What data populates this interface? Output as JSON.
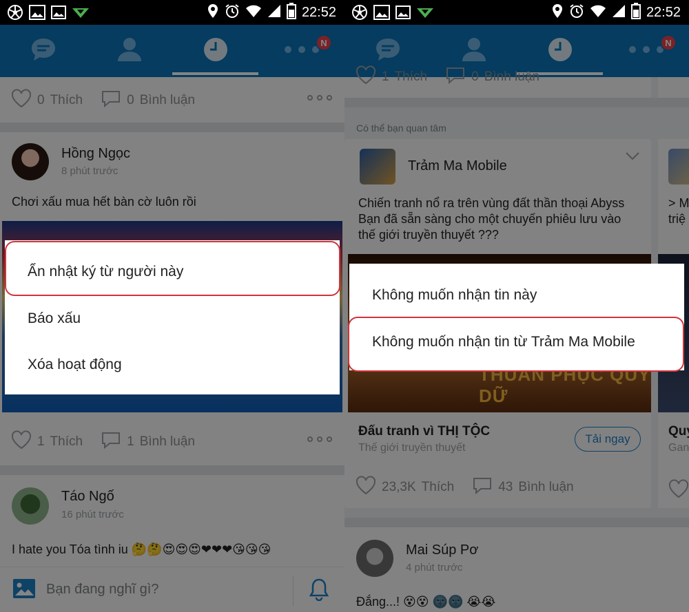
{
  "status_bar": {
    "time": "22:52"
  },
  "nav": {
    "badge": "N"
  },
  "left": {
    "top_post": {
      "likes": "0",
      "like_label": "Thích",
      "comments": "0",
      "comment_label": "Bình luận"
    },
    "post1": {
      "author": "Hồng Ngọc",
      "time": "8 phút trước",
      "text": "Chơi xấu mua hết bàn cờ luôn rồi",
      "likes": "1",
      "like_label": "Thích",
      "comments": "1",
      "comment_label": "Bình luận"
    },
    "post2": {
      "author": "Táo Ngố",
      "time": "16 phút trước",
      "text": "I hate you Tóa tình iu 🤔🤔😍😍😍❤❤❤😘😘😘"
    },
    "composer": {
      "placeholder": "Bạn đang nghĩ gì?"
    },
    "menu": {
      "items": [
        "Ẩn nhật ký từ người này",
        "Báo xấu",
        "Xóa hoạt động"
      ]
    }
  },
  "right": {
    "top_post": {
      "likes": "1",
      "like_label": "Thích",
      "comments": "0",
      "comment_label": "Bình luận"
    },
    "suggest_label": "Có thể bạn quan tâm",
    "ad": {
      "name": "Trảm Ma Mobile",
      "text": "Chiến tranh nổ ra trên vùng đất thần thoại Abyss Bạn đã sẵn sàng cho một chuyến phiêu lưu vào thế giới truyền thuyết ???",
      "banner_text": "THUẦN PHỤC QUỶ DỮ",
      "title": "Đấu tranh vì THỊ TỘC",
      "subtitle": "Thế giới truyền thuyết",
      "install_label": "Tải ngay",
      "likes": "23,3K",
      "like_label": "Thích",
      "comments": "43",
      "comment_label": "Bình luận"
    },
    "next_ad": {
      "text": "> M\ntriệ",
      "title": "Quy",
      "subtitle": "Gan"
    },
    "post": {
      "author": "Mai Súp Pơ",
      "time": "4 phút trước",
      "text": "Đắng...! 😵😵 🌚🌚 😭😭"
    },
    "menu": {
      "items": [
        "Không muốn nhận tin này",
        "Không muốn nhận tin từ Trảm Ma Mobile"
      ]
    }
  },
  "colors": {
    "appbar": "#0a73b7",
    "highlight": "#d0333a",
    "badge": "#e8424b",
    "link": "#1c7fc3"
  }
}
